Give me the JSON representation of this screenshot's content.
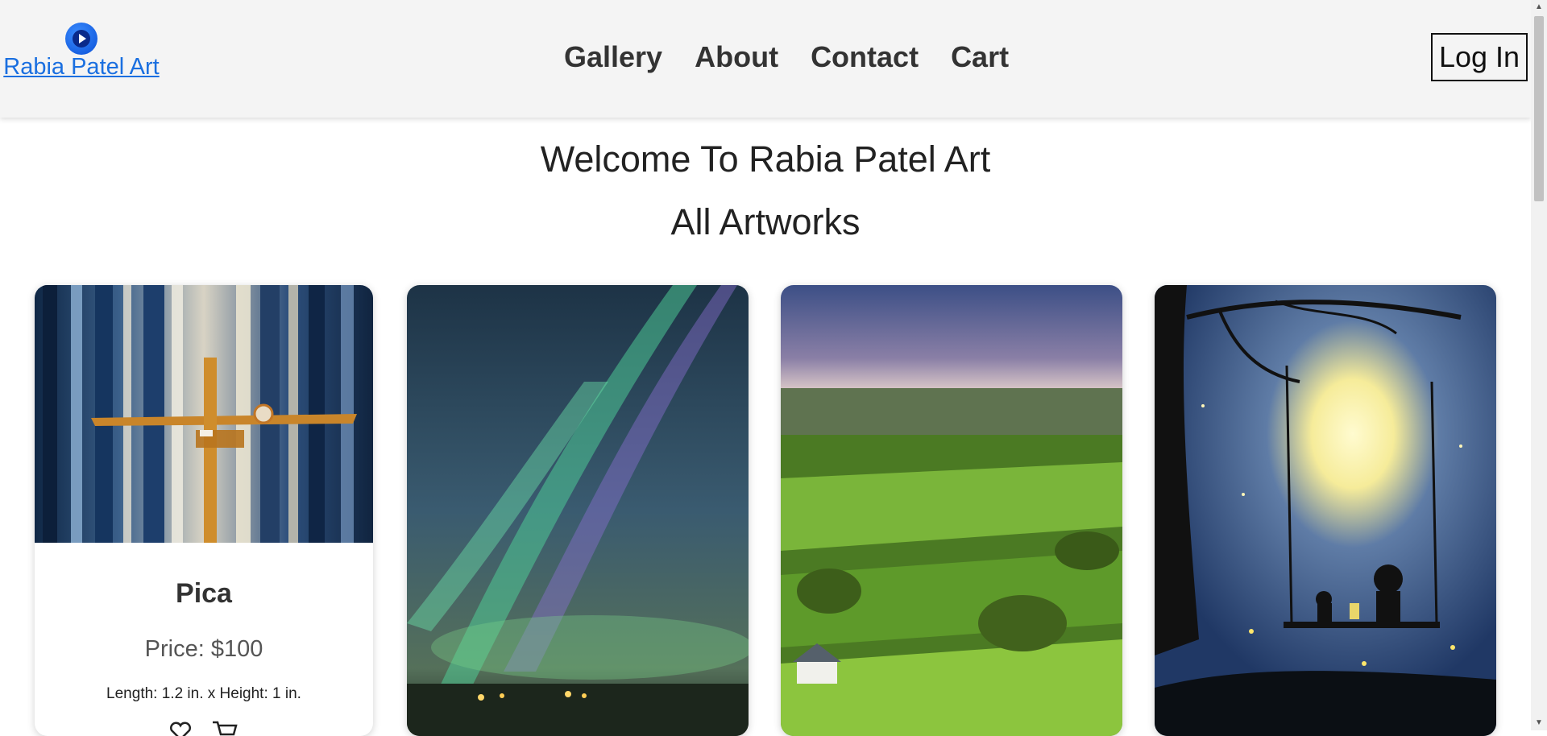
{
  "header": {
    "brand_name": "Rabia Patel Art",
    "brand_icon": "play-circle-icon",
    "nav": [
      {
        "label": "Gallery"
      },
      {
        "label": "About"
      },
      {
        "label": "Contact"
      },
      {
        "label": "Cart"
      }
    ],
    "login_label": "Log In"
  },
  "main": {
    "welcome": "Welcome To Rabia Patel Art",
    "section_title": "All Artworks",
    "artworks": [
      {
        "title": "Pica",
        "price": "Price: $100",
        "dimensions": "Length: 1.2 in. x Height: 1 in.",
        "action_icons": [
          "heart-icon",
          "cart-icon"
        ]
      },
      {
        "image": "aurora-landscape-painting"
      },
      {
        "image": "green-fields-landscape-painting"
      },
      {
        "image": "moon-swing-night-painting"
      }
    ]
  },
  "colors": {
    "header_bg": "#f4f4f4",
    "link": "#1a6fe0",
    "text": "#222222"
  }
}
